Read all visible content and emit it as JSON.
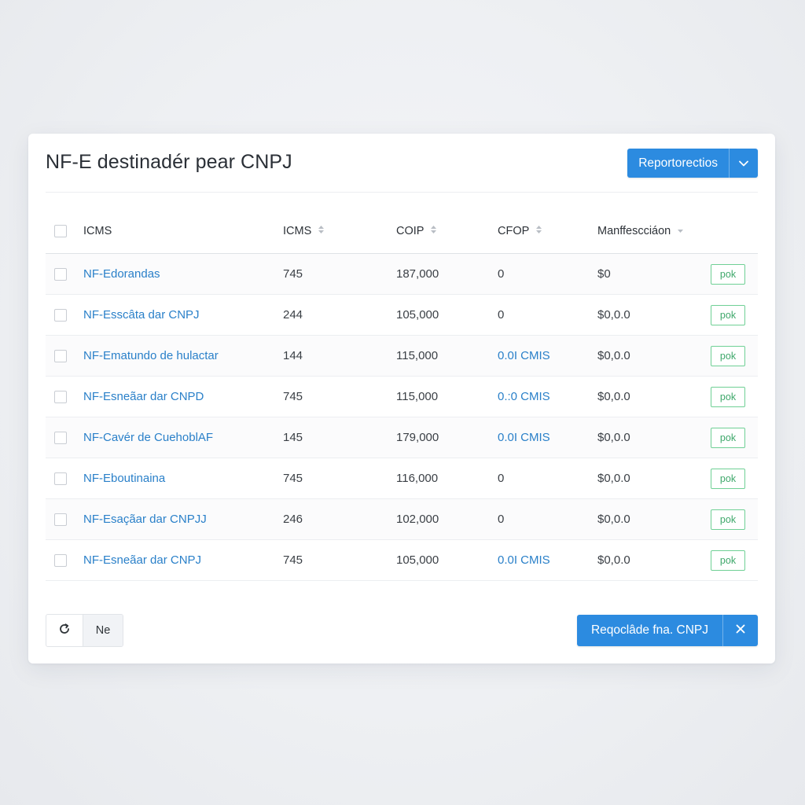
{
  "header": {
    "title": "NF-E destinadér pear CNPJ",
    "report_button_label": "Reportorectios"
  },
  "table": {
    "columns": {
      "name": "ICMS",
      "icms": "ICMS",
      "coip": "COIP",
      "cfop": "CFOP",
      "manif": "Manffescciáon"
    },
    "rows": [
      {
        "name": "NF-Edorandas",
        "icms": "745",
        "coip": "187,000",
        "cfop": "0",
        "manif": "$0",
        "badge": "pok"
      },
      {
        "name": "NF-Esscâta dar CNPJ",
        "icms": "244",
        "coip": "105,000",
        "cfop": "0",
        "manif": "$0,0.0",
        "badge": "pok"
      },
      {
        "name": "NF-Ematundo de hulactar",
        "icms": "144",
        "coip": "115,000",
        "cfop": "0.0I CMIS",
        "manif": "$0,0.0",
        "badge": "pok"
      },
      {
        "name": "NF-Esneãar dar CNPD",
        "icms": "745",
        "coip": "115,000",
        "cfop": "0.:0 CMIS",
        "manif": "$0,0.0",
        "badge": "pok"
      },
      {
        "name": "NF-Cavér de CuehoblAF",
        "icms": "145",
        "coip": "179,000",
        "cfop": "0.0I CMIS",
        "manif": "$0,0.0",
        "badge": "pok"
      },
      {
        "name": "NF-Eboutinaina",
        "icms": "745",
        "coip": "116,000",
        "cfop": "0",
        "manif": "$0,0.0",
        "badge": "pok"
      },
      {
        "name": "NF-Esaçãar dar CNPJJ",
        "icms": "246",
        "coip": "102,000",
        "cfop": "0",
        "manif": "$0,0.0",
        "badge": "pok"
      },
      {
        "name": "NF-Esneãar dar CNPJ",
        "icms": "745",
        "coip": "105,000",
        "cfop": "0.0I CMIS",
        "manif": "$0,0.0",
        "badge": "pok"
      }
    ]
  },
  "footer": {
    "left_label": "Ne",
    "action_label": "Reqoclâde fna. CNPJ"
  },
  "colors": {
    "accent": "#2c8be0",
    "link": "#2a80c9",
    "badge_green": "#3fa86b"
  },
  "icons": {
    "header_caret": "chevron-down-icon",
    "sort": "sort-icon",
    "refresh": "refresh-icon",
    "close": "close-icon"
  }
}
